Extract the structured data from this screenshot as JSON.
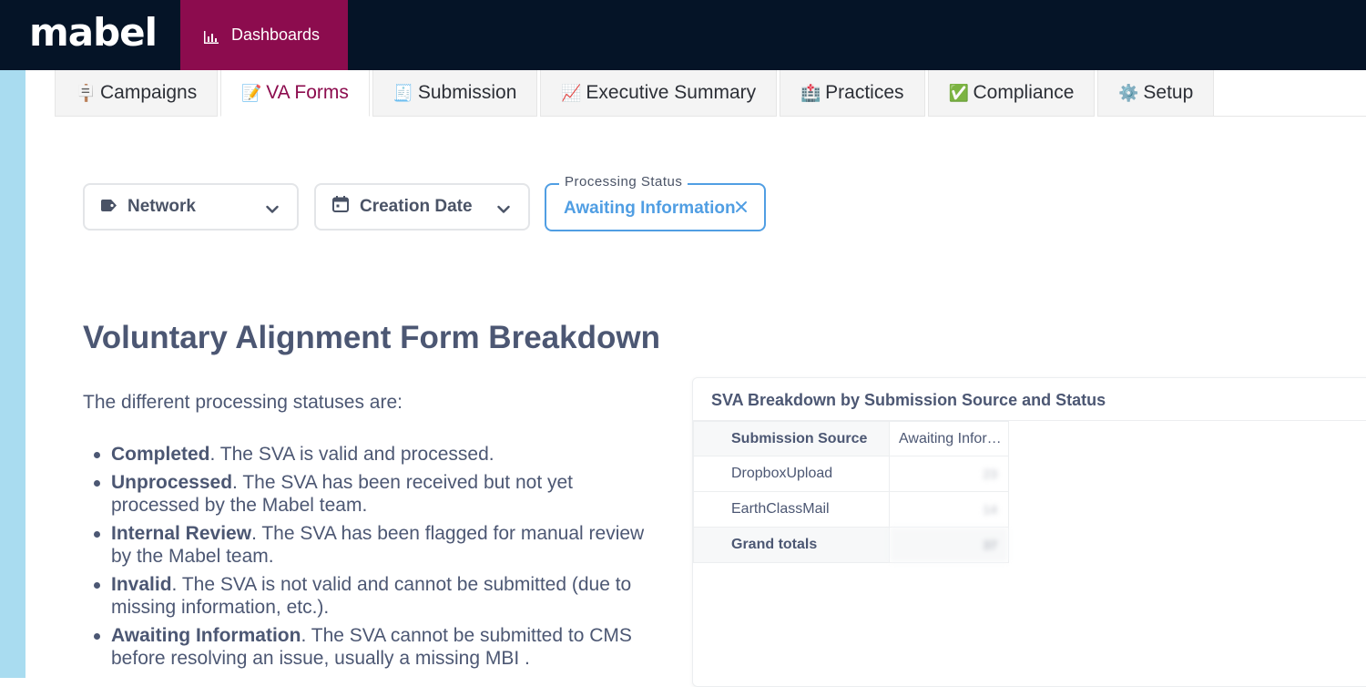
{
  "app": {
    "logo": "mabel",
    "nav": {
      "dashboards_label": "Dashboards"
    }
  },
  "tabs": [
    {
      "emoji": "🪧",
      "label": "Campaigns",
      "active": false
    },
    {
      "emoji": "📝",
      "label": "VA Forms",
      "active": true
    },
    {
      "emoji": "🧾",
      "label": "Submission",
      "active": false
    },
    {
      "emoji": "📈",
      "label": "Executive Summary",
      "active": false
    },
    {
      "emoji": "🏥",
      "label": "Practices",
      "active": false
    },
    {
      "emoji": "✅",
      "label": "Compliance",
      "active": false
    },
    {
      "emoji": "⚙️",
      "label": "Setup",
      "active": false
    }
  ],
  "filters": {
    "network": {
      "label": "Network",
      "icon": "tag-icon"
    },
    "creation_date": {
      "label": "Creation Date",
      "icon": "calendar-icon"
    },
    "processing_status": {
      "legend": "Processing Status",
      "value": "Awaiting Information"
    }
  },
  "content": {
    "title": "Voluntary Alignment Form Breakdown",
    "intro": "The different processing statuses are:",
    "statuses": [
      {
        "name": "Completed",
        "desc": ". The SVA is valid and processed."
      },
      {
        "name": "Unprocessed",
        "desc": ". The SVA has been received but not yet processed by the Mabel team."
      },
      {
        "name": "Internal Review",
        "desc": ". The SVA has been flagged for manual review by the Mabel team."
      },
      {
        "name": "Invalid",
        "desc": ". The SVA is not valid and cannot be submitted (due to missing information, etc.)."
      },
      {
        "name": "Awaiting Information",
        "desc": ". The SVA cannot be submitted to CMS before resolving an issue, usually a missing MBI ."
      }
    ]
  },
  "card": {
    "title": "SVA Breakdown by Submission Source and Status",
    "table": {
      "row_header": "Submission Source",
      "col_header": "Awaiting Infor…",
      "rows": [
        {
          "source": "DropboxUpload",
          "value": "23"
        },
        {
          "source": "EarthClassMail",
          "value": "14"
        }
      ],
      "total_label": "Grand totals",
      "total_value": "37"
    }
  },
  "colors": {
    "topbar": "#051427",
    "brand": "#8c0c4e",
    "accent_blue": "#509ee3",
    "text": "#4c5773",
    "sidestrip": "#a9dcf0"
  }
}
